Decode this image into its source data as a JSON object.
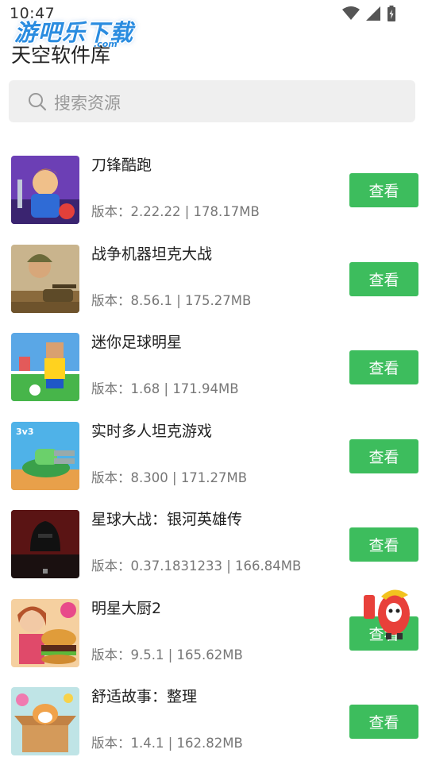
{
  "status": {
    "time": "10:47"
  },
  "watermark": {
    "text": "游吧乐下载",
    "sub": ".com"
  },
  "header": {
    "title": "天空软件库"
  },
  "search": {
    "placeholder": "搜索资源"
  },
  "apps": [
    {
      "name": "刀锋酷跑",
      "version_label": "版本：",
      "version": "2.22.22",
      "sep": "|",
      "size": "178.17MB",
      "button": "查看",
      "icon": "runner-hero-icon"
    },
    {
      "name": "战争机器坦克大战",
      "version_label": "版本：",
      "version": "8.56.1",
      "sep": "|",
      "size": "175.27MB",
      "button": "查看",
      "icon": "soldier-tank-icon"
    },
    {
      "name": "迷你足球明星",
      "version_label": "版本：",
      "version": "1.68",
      "sep": "|",
      "size": "171.94MB",
      "button": "查看",
      "icon": "soccer-player-icon"
    },
    {
      "name": "实时多人坦克游戏",
      "version_label": "版本：",
      "version": "8.300",
      "sep": "|",
      "size": "171.27MB",
      "button": "查看",
      "icon": "tank-3v3-icon"
    },
    {
      "name": "星球大战：银河英雄传",
      "version_label": "版本：",
      "version": "0.37.1831233",
      "sep": "|",
      "size": "166.84MB",
      "button": "查看",
      "icon": "star-wars-icon"
    },
    {
      "name": "明星大厨2",
      "version_label": "版本：",
      "version": "9.5.1",
      "sep": "|",
      "size": "165.62MB",
      "button": "查看",
      "icon": "chef-burger-icon"
    },
    {
      "name": "舒适故事：整理",
      "version_label": "版本：",
      "version": "1.4.1",
      "sep": "|",
      "size": "162.82MB",
      "button": "查看",
      "icon": "corgi-box-icon"
    }
  ],
  "colors": {
    "button": "#3dbd5d",
    "search_bg": "#efefef",
    "watermark": "#2a8ce0"
  }
}
